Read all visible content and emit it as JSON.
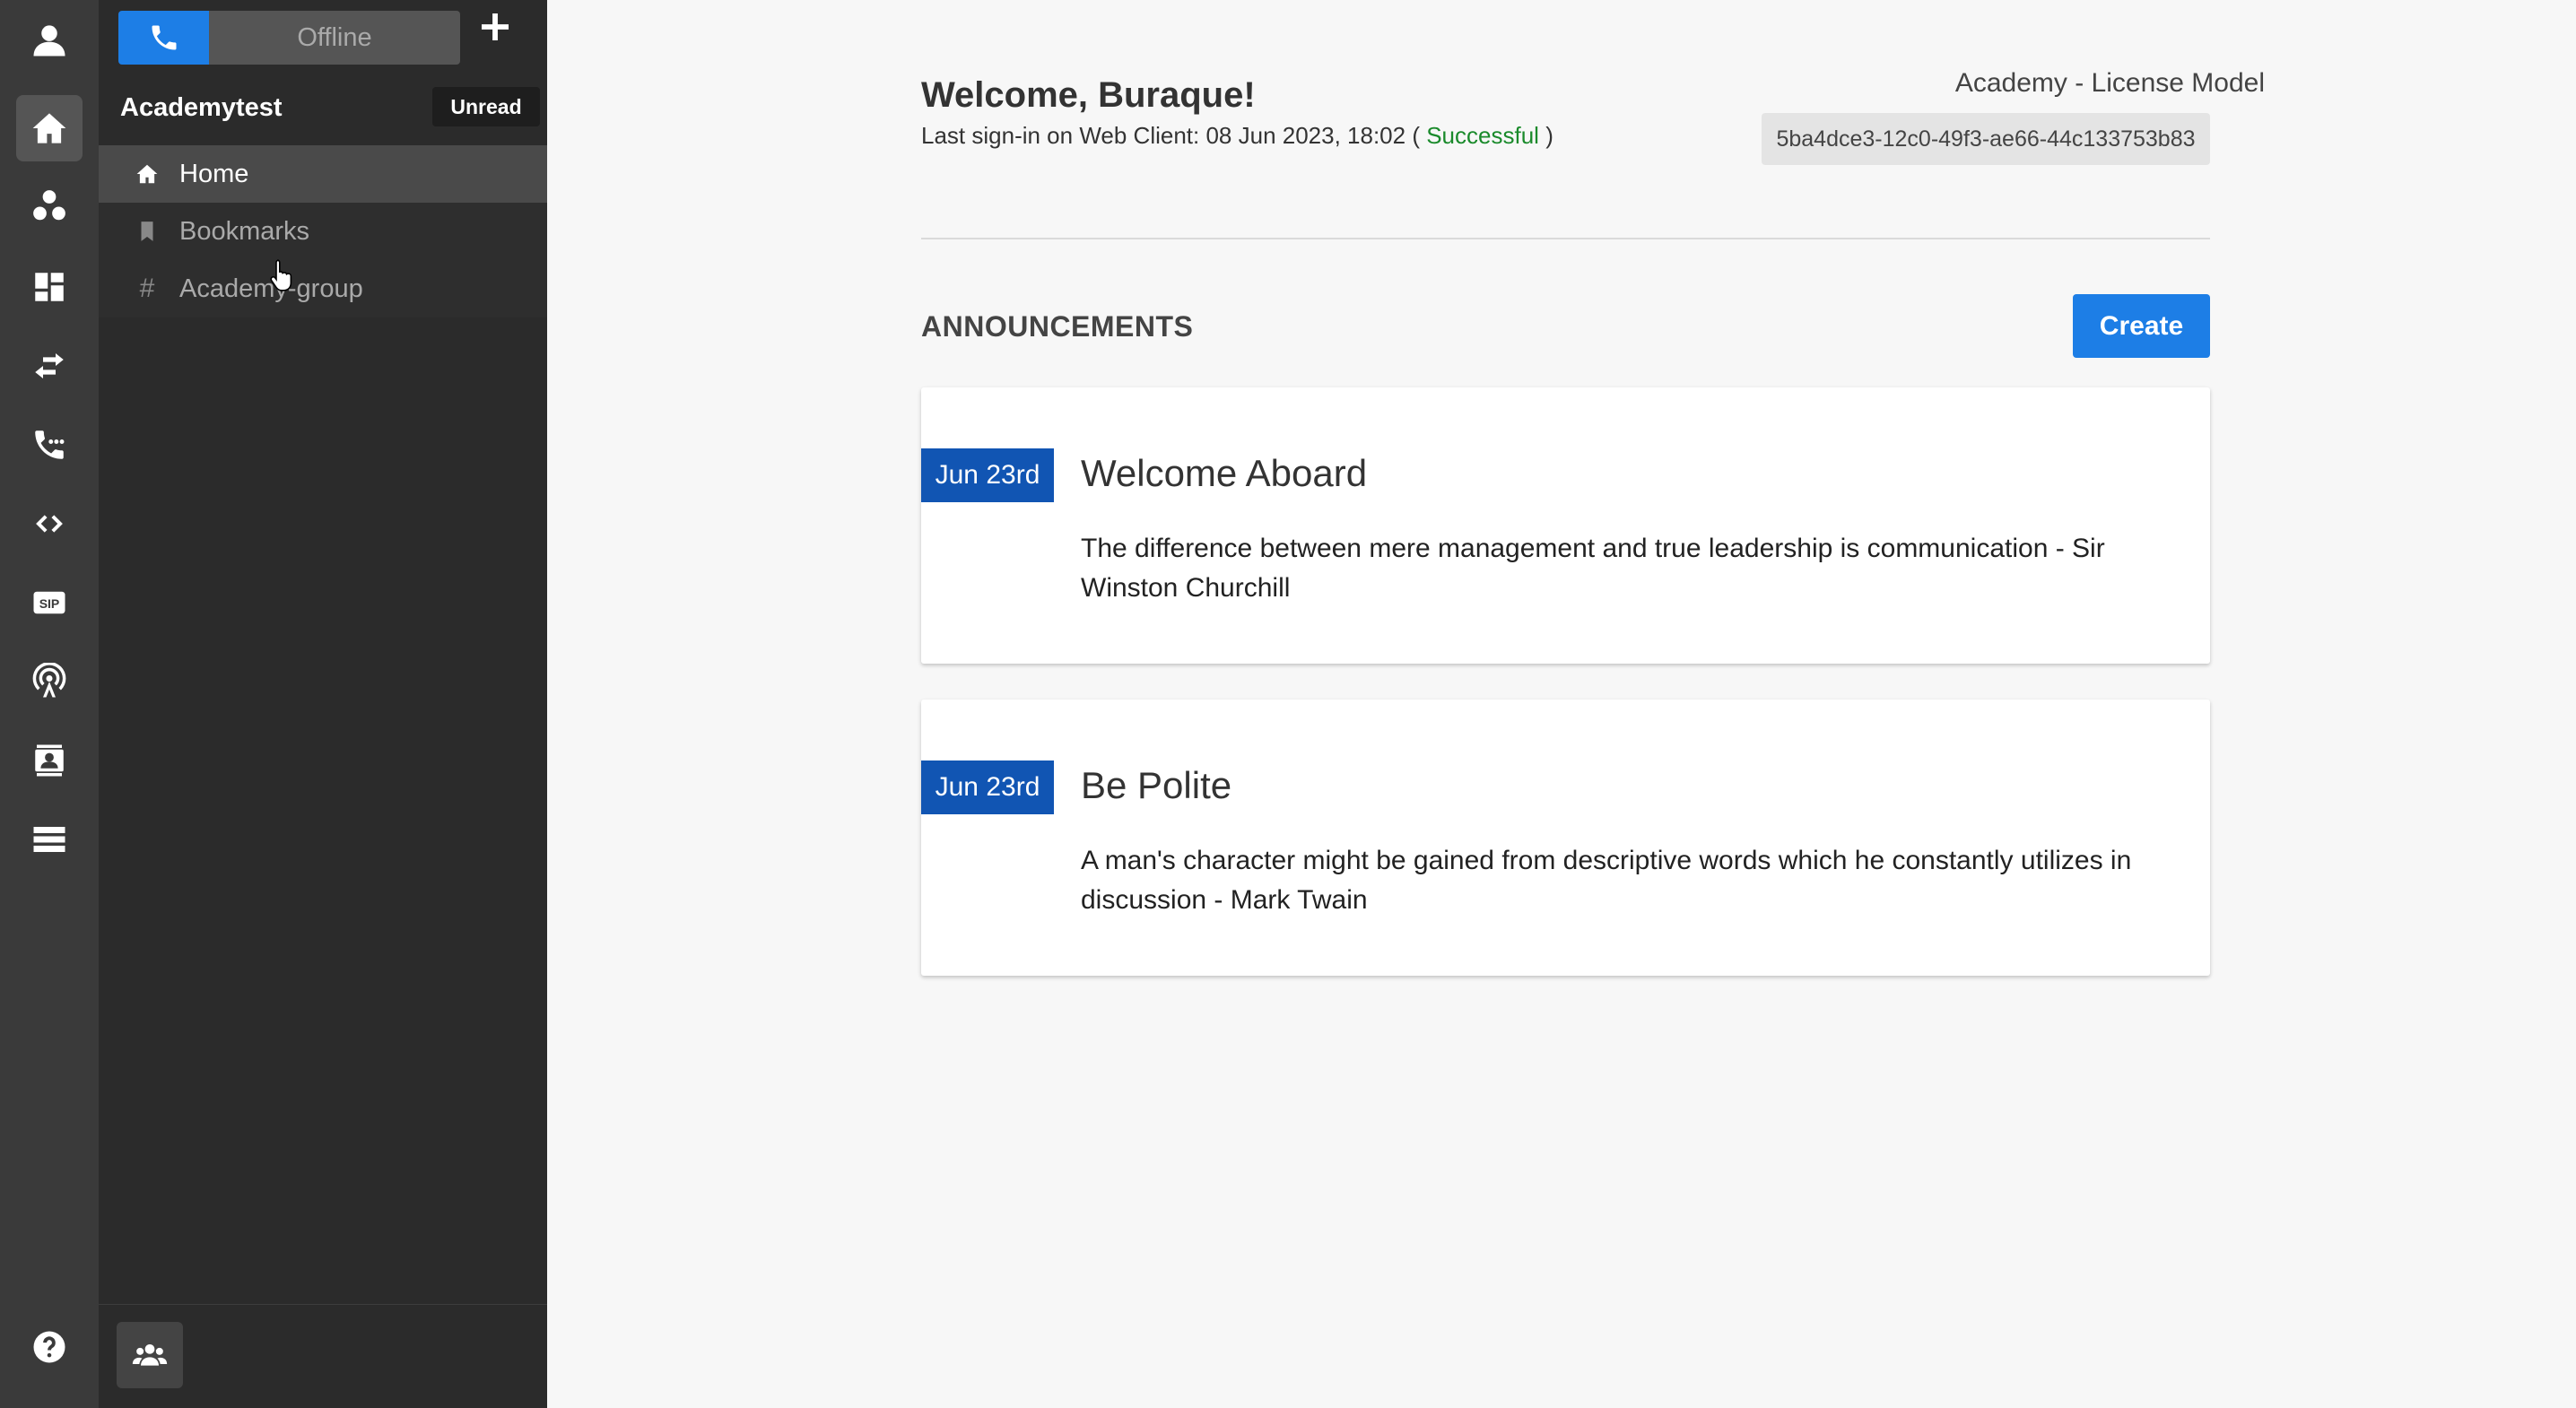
{
  "rail": {
    "items": [
      "profile-icon",
      "home-icon",
      "contacts-icon",
      "dashboard-icon",
      "transfer-icon",
      "call-log-icon",
      "code-icon",
      "sip-icon",
      "broadcast-icon",
      "contact-card-icon",
      "list-icon",
      "help-icon"
    ]
  },
  "panel": {
    "status": "Offline",
    "workspace": "Academytest",
    "unread_label": "Unread",
    "channels": [
      {
        "label": "Home",
        "icon": "home-icon"
      },
      {
        "label": "Bookmarks",
        "icon": "bookmark-icon"
      },
      {
        "label": "Academy-group",
        "icon": "hash-icon"
      }
    ]
  },
  "main": {
    "welcome": "Welcome, Buraque!",
    "signin_prefix": "Last sign-in on Web Client: 08 Jun 2023, 18:02 (",
    "signin_status": "Successful",
    "signin_suffix": ")",
    "license_title": "Academy - License Model",
    "license_key": "5ba4dce3-12c0-49f3-ae66-44c133753b83",
    "announcements_heading": "ANNOUNCEMENTS",
    "create_label": "Create",
    "announcements": [
      {
        "date": "Jun 23rd",
        "title": "Welcome Aboard",
        "body": "The difference between mere management and true leadership is communication - Sir Winston Churchill"
      },
      {
        "date": "Jun 23rd",
        "title": "Be Polite",
        "body": "A man's character might be gained from descriptive words which he constantly utilizes in discussion - Mark Twain"
      }
    ]
  },
  "colors": {
    "accent": "#1d7ee6",
    "date_badge": "#1155b3",
    "success": "#1a8a2b",
    "rail_bg": "#3a3a3a",
    "panel_bg": "#2b2b2b"
  }
}
